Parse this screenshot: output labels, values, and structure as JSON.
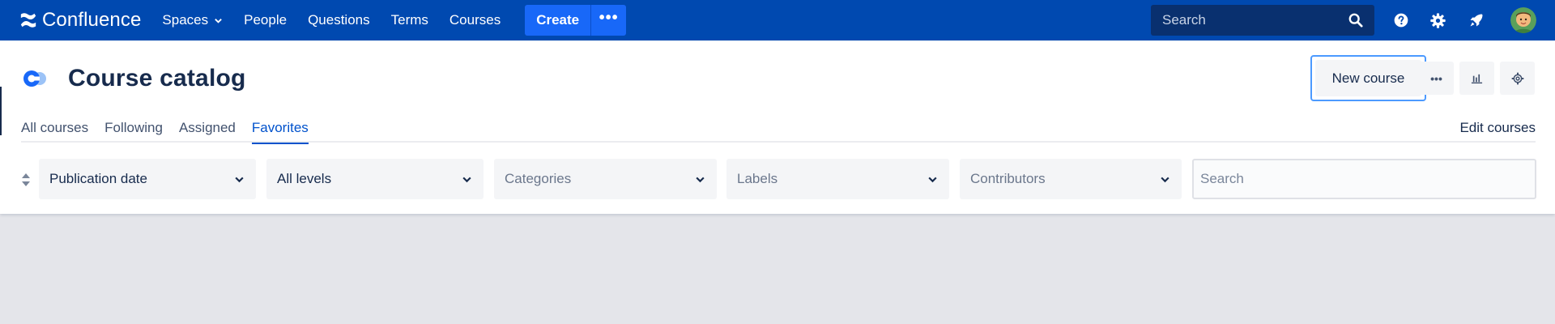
{
  "app": {
    "name": "Confluence"
  },
  "topnav": {
    "items": [
      {
        "label": "Spaces",
        "has_dropdown": true
      },
      {
        "label": "People"
      },
      {
        "label": "Questions"
      },
      {
        "label": "Terms"
      },
      {
        "label": "Courses"
      }
    ],
    "create_label": "Create",
    "more_label": "•••",
    "search_placeholder": "Search",
    "icons": [
      "help-icon",
      "gear-icon",
      "rocket-icon"
    ]
  },
  "page": {
    "title": "Course catalog",
    "new_course_label": "New course",
    "more_actions_label": "•••",
    "edit_courses_label": "Edit courses"
  },
  "tabs": [
    {
      "label": "All courses",
      "active": false
    },
    {
      "label": "Following",
      "active": false
    },
    {
      "label": "Assigned",
      "active": false
    },
    {
      "label": "Favorites",
      "active": true
    }
  ],
  "filters": {
    "sort_by": "Publication date",
    "level": "All levels",
    "categories_placeholder": "Categories",
    "labels_placeholder": "Labels",
    "contributors_placeholder": "Contributors",
    "search_placeholder": "Search"
  },
  "colors": {
    "nav_bg": "#0049b0",
    "create_btn": "#1868f8",
    "active_tab": "#0052cc",
    "page_bg": "#e4e5ea"
  }
}
